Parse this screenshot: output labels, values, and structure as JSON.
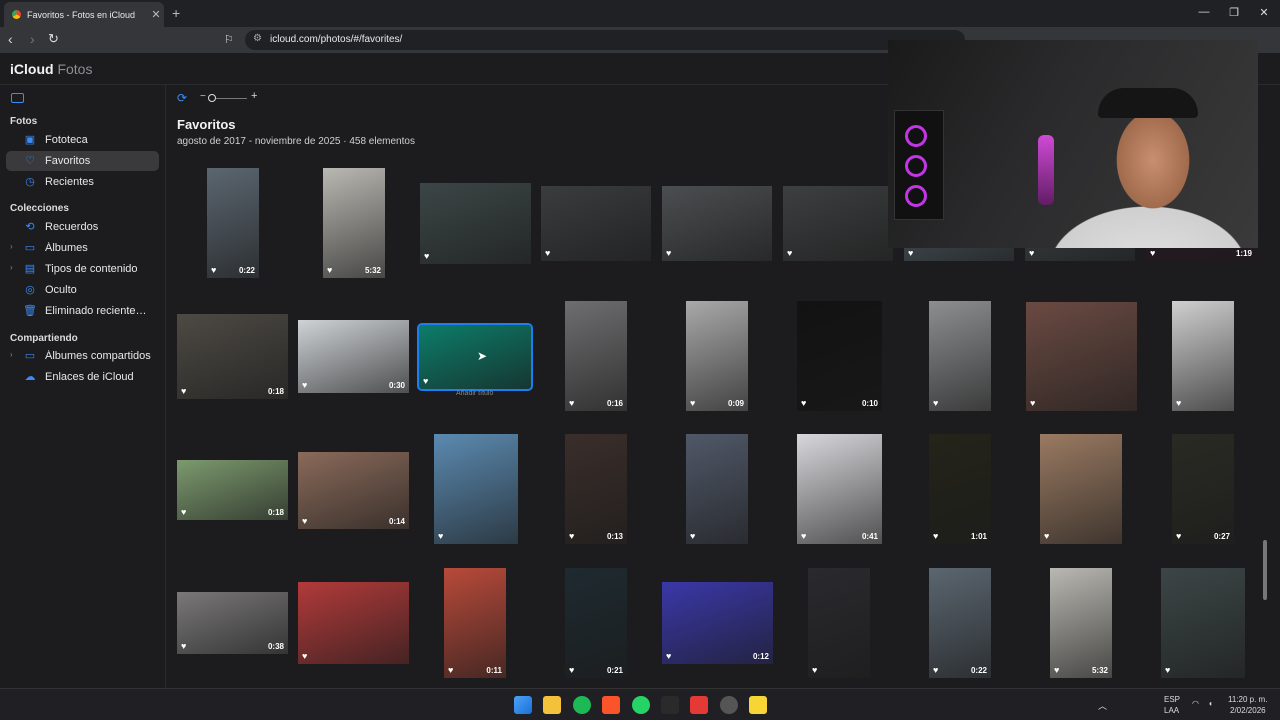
{
  "browser": {
    "tab_title": "Favoritos - Fotos en iCloud",
    "url": "icloud.com/photos/#/favorites/"
  },
  "app": {
    "logo_brand": "iCloud",
    "logo_app": "Fotos"
  },
  "sidebar": {
    "section_fotos": "Fotos",
    "section_colecciones": "Colecciones",
    "section_compartiendo": "Compartiendo",
    "items": [
      {
        "label": "Fototeca"
      },
      {
        "label": "Favoritos"
      },
      {
        "label": "Recientes"
      },
      {
        "label": "Recuerdos"
      },
      {
        "label": "Álbumes"
      },
      {
        "label": "Tipos de contenido"
      },
      {
        "label": "Oculto"
      },
      {
        "label": "Eliminado recientemente"
      },
      {
        "label": "Álbumes compartidos"
      },
      {
        "label": "Enlaces de iCloud"
      }
    ]
  },
  "main": {
    "title": "Favoritos",
    "subtitle": "agosto de 2017 - noviembre de 2025 · 458 elementos",
    "zoom_plus": "+",
    "selected_caption": "Añadir título",
    "thumbs": [
      {
        "duration": "0:22",
        "color": "#5b6670"
      },
      {
        "duration": "5:32",
        "color": "#b9b8b2"
      },
      {
        "duration": "",
        "color": "#3c4646"
      },
      {
        "duration": "",
        "color": "#3a3c3e"
      },
      {
        "duration": "",
        "color": "#4b4e50"
      },
      {
        "duration": "",
        "color": "#3d3f40"
      },
      {
        "duration": "",
        "color": "#4e5a62"
      },
      {
        "duration": "",
        "color": "#3f4346"
      },
      {
        "duration": "1:19",
        "color": "#2a1a24"
      },
      {
        "duration": "0:18",
        "color": "#4d4a44"
      },
      {
        "duration": "0:30",
        "color": "#cfd3d6"
      },
      {
        "duration": "",
        "color": "#0c7d6a"
      },
      {
        "duration": "0:16",
        "color": "#6e6e70"
      },
      {
        "duration": "0:09",
        "color": "#a9a9a9"
      },
      {
        "duration": "0:10",
        "color": "#121212"
      },
      {
        "duration": "",
        "color": "#8d8e90"
      },
      {
        "duration": "",
        "color": "#6a4a42"
      },
      {
        "duration": "",
        "color": "#cfcfcf"
      },
      {
        "duration": "0:18",
        "color": "#7c9a6e"
      },
      {
        "duration": "0:14",
        "color": "#8a6a5a"
      },
      {
        "duration": "",
        "color": "#5b8ab0"
      },
      {
        "duration": "0:13",
        "color": "#3a2e2a"
      },
      {
        "duration": "",
        "color": "#505868"
      },
      {
        "duration": "0:41",
        "color": "#d8d8dc"
      },
      {
        "duration": "1:01",
        "color": "#24241a"
      },
      {
        "duration": "",
        "color": "#9a7a62"
      },
      {
        "duration": "0:27",
        "color": "#2a2a24"
      },
      {
        "duration": "0:38",
        "color": "#7a7878"
      },
      {
        "duration": "",
        "color": "#b23a3a"
      },
      {
        "duration": "0:11",
        "color": "#b84a3a"
      },
      {
        "duration": "0:21",
        "color": "#1e2a30"
      },
      {
        "duration": "0:12",
        "color": "#3a38a8"
      },
      {
        "duration": "",
        "color": "#2a2a2e"
      }
    ]
  },
  "taskbar": {
    "language": "ESP",
    "layout": "LAA",
    "time": "11:20 p. m.",
    "date": "2/02/2026"
  }
}
